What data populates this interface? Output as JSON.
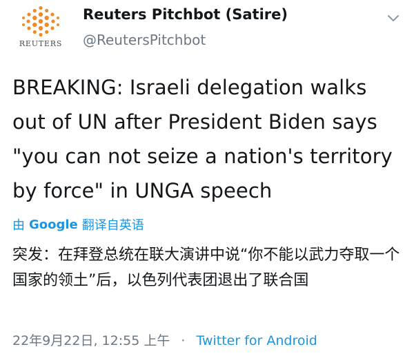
{
  "tweet": {
    "avatar_label": "REUTERS",
    "display_name": "Reuters Pitchbot (Satire)",
    "handle": "@ReutersPitchbot",
    "text": "BREAKING: Israeli delegation walks out of UN after President Biden says \"you can not seize a nation's territory by force\" in UNGA speech",
    "translate": {
      "by": "由",
      "engine": "Google",
      "action": "翻译自英语"
    },
    "translated_text": "突发：在拜登总统在联大演讲中说“你不能以武力夺取一个国家的领土”后，以色列代表团退出了联合国",
    "timestamp": "22年9月22日, 12:55 上午",
    "separator": "·",
    "source": "Twitter for Android"
  },
  "colors": {
    "text": "#14171a",
    "secondary": "#6b7782",
    "link": "#1b95e0",
    "logo": "#f08a24"
  },
  "icons": {
    "avatar": "reuters-logo-icon",
    "menu": "chevron-down-icon"
  }
}
